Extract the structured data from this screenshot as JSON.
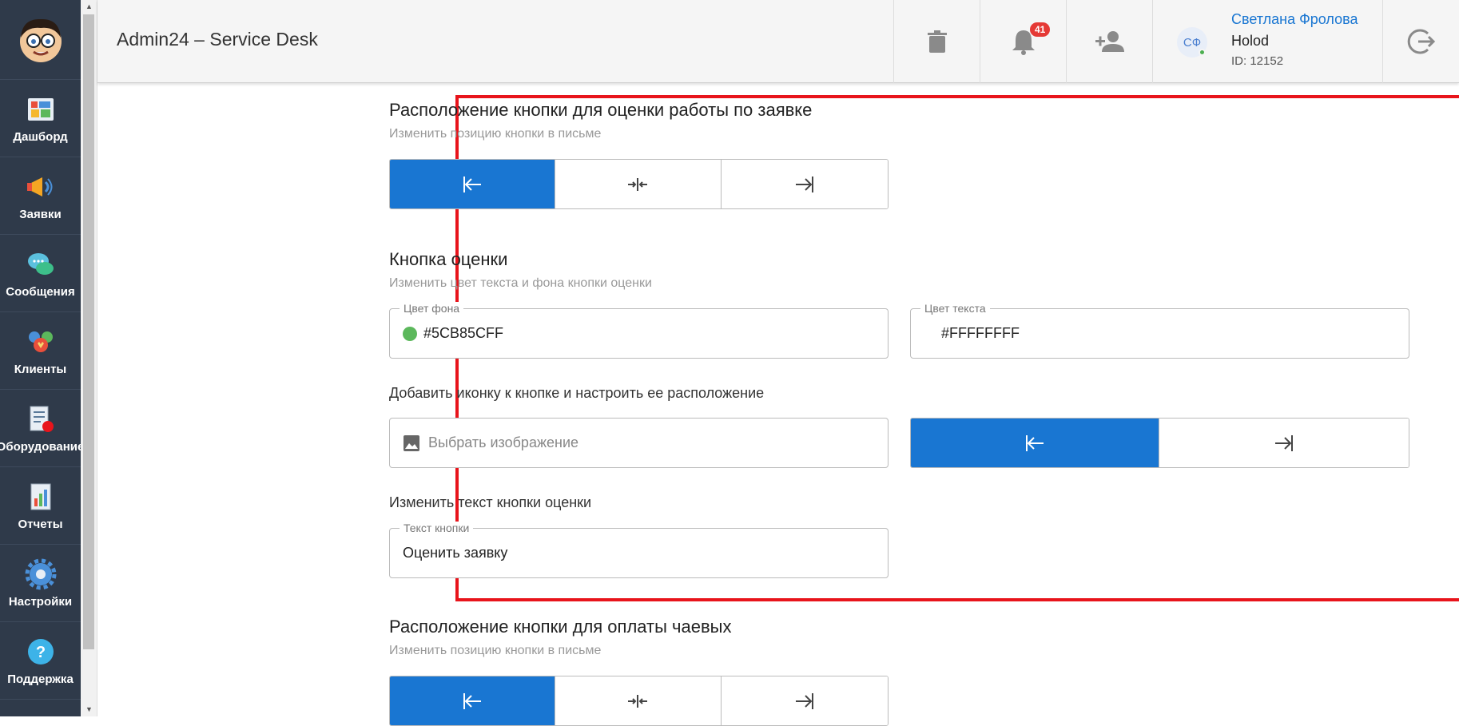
{
  "sidebar": {
    "items": [
      {
        "label": "Дашборд",
        "icon": "dashboard-icon"
      },
      {
        "label": "Заявки",
        "icon": "megaphone-icon"
      },
      {
        "label": "Сообщения",
        "icon": "chat-icon"
      },
      {
        "label": "Клиенты",
        "icon": "clients-icon"
      },
      {
        "label": "Оборудование",
        "icon": "equipment-icon"
      },
      {
        "label": "Отчеты",
        "icon": "reports-icon"
      },
      {
        "label": "Настройки",
        "icon": "gear-icon"
      },
      {
        "label": "Поддержка",
        "icon": "help-icon"
      }
    ]
  },
  "header": {
    "title": "Admin24 – Service Desk",
    "notifications_count": "41",
    "user": {
      "initials": "СФ",
      "name": "Светлана Фролова",
      "org": "Holod",
      "id": "ID: 12152"
    }
  },
  "rating_position": {
    "title": "Расположение кнопки для оценки работы по заявке",
    "subtitle": "Изменить позицию кнопки в письме",
    "options": [
      "align-left",
      "align-center",
      "align-right"
    ],
    "selected": 0
  },
  "rating_button": {
    "title": "Кнопка оценки",
    "subtitle": "Изменить цвет текста и фона кнопки оценки",
    "bg_color_label": "Цвет фона",
    "bg_color_value": "#5CB85CFF",
    "bg_swatch": "#5CB85C",
    "text_color_label": "Цвет текста",
    "text_color_value": "#FFFFFFFF",
    "icon_section_label": "Добавить иконку к кнопке и настроить ее расположение",
    "image_placeholder": "Выбрать изображение",
    "icon_position_options": [
      "icon-left",
      "icon-right"
    ],
    "icon_position_selected": 0,
    "text_section_label": "Изменить текст кнопки оценки",
    "text_field_label": "Текст кнопки",
    "text_field_value": "Оценить заявку"
  },
  "tips_position": {
    "title": "Расположение кнопки для оплаты чаевых",
    "subtitle": "Изменить позицию кнопки в письме",
    "selected": 0
  },
  "colors": {
    "accent": "#1976D2",
    "sidebar": "#2F3A4A",
    "highlight": "#E8141B"
  }
}
